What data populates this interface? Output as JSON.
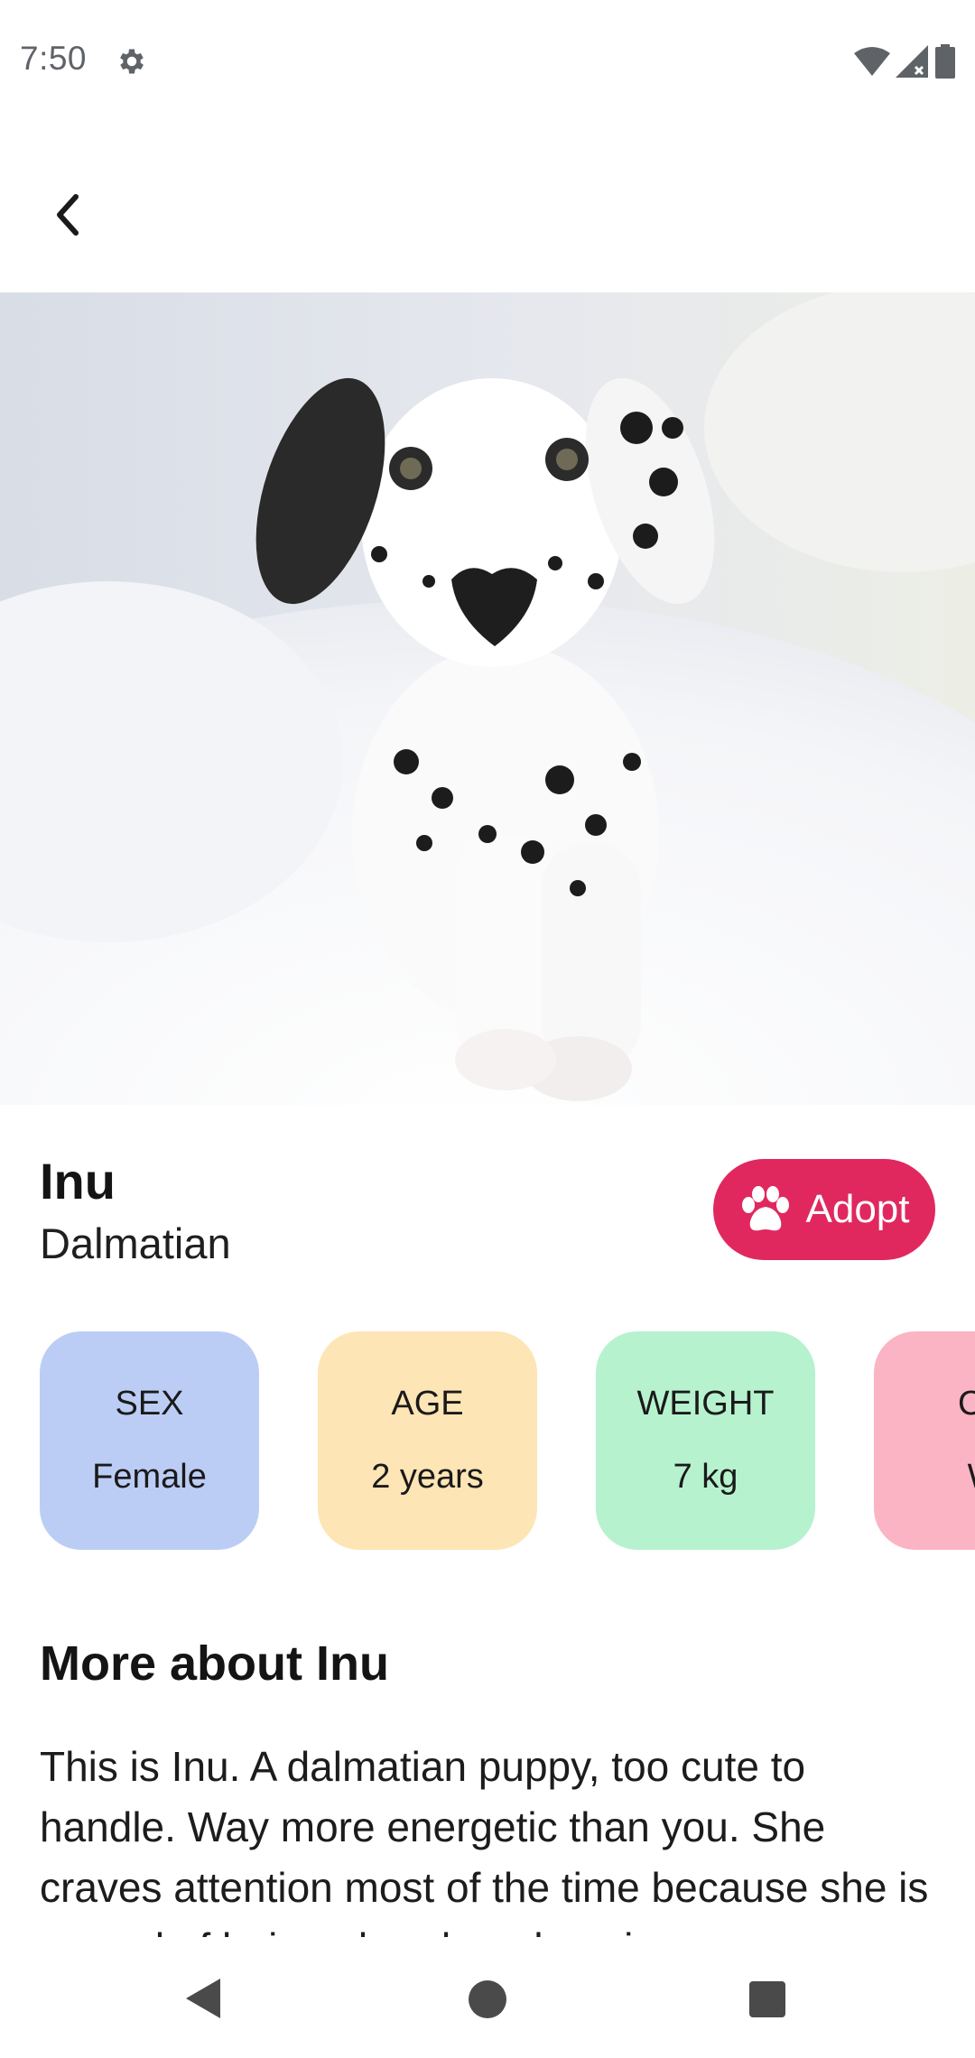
{
  "status_bar": {
    "time": "7:50",
    "icons": [
      "gear-icon",
      "wifi-icon",
      "signal-icon",
      "battery-icon"
    ]
  },
  "app_bar": {
    "back_icon": "chevron-left-icon"
  },
  "hero": {
    "image": "dalmatian-puppy-photo"
  },
  "pet": {
    "name": "Inu",
    "breed": "Dalmatian"
  },
  "adopt": {
    "label": "Adopt",
    "icon": "paw-icon",
    "color": "#e0285f"
  },
  "stats": [
    {
      "label": "SEX",
      "value": "Female",
      "color": "#bccdf5"
    },
    {
      "label": "AGE",
      "value": "2 years",
      "color": "#fde5b5"
    },
    {
      "label": "WEIGHT",
      "value": "7 kg",
      "color": "#b7f2cf"
    },
    {
      "label": "CO",
      "value": "W",
      "color": "#fbb4c3"
    }
  ],
  "about": {
    "title": "More about Inu",
    "text": "This is Inu. A dalmatian puppy, too cute to handle. Way more energetic than you. She craves attention most of the time because she is scared of being abandoned again."
  },
  "nav_bar": {
    "buttons": [
      "back-triangle-icon",
      "home-circle-icon",
      "recents-square-icon"
    ]
  }
}
